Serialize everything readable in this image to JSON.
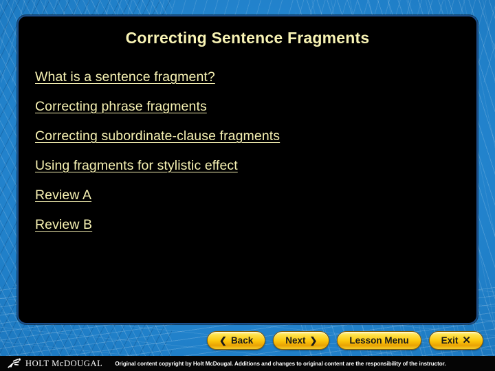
{
  "slide": {
    "title": "Correcting Sentence Fragments",
    "title_color": "#f8f3b4",
    "panel_background": "#000000",
    "background_color": "#2080c9"
  },
  "topics": [
    {
      "label": "What is a sentence fragment?"
    },
    {
      "label": "Correcting phrase fragments"
    },
    {
      "label": "Correcting subordinate-clause fragments"
    },
    {
      "label": "Using fragments for stylistic effect"
    },
    {
      "label": "Review A"
    },
    {
      "label": "Review B"
    }
  ],
  "navigation": {
    "back": {
      "label": "Back",
      "icon": "chevron-left",
      "glyph": "❮"
    },
    "next": {
      "label": "Next",
      "icon": "chevron-right",
      "glyph": "❯"
    },
    "lesson_menu": {
      "label": "Lesson Menu"
    },
    "exit": {
      "label": "Exit",
      "icon": "close",
      "glyph": "✕"
    },
    "button_color": "#fcc70d"
  },
  "footer": {
    "brand": "HOLT McDOUGAL",
    "logo_icon": "holt-mcdougal-runner-logo",
    "copyright": "Original content copyright by Holt McDougal.  Additions and changes to original content are the responsibility of the instructor."
  }
}
